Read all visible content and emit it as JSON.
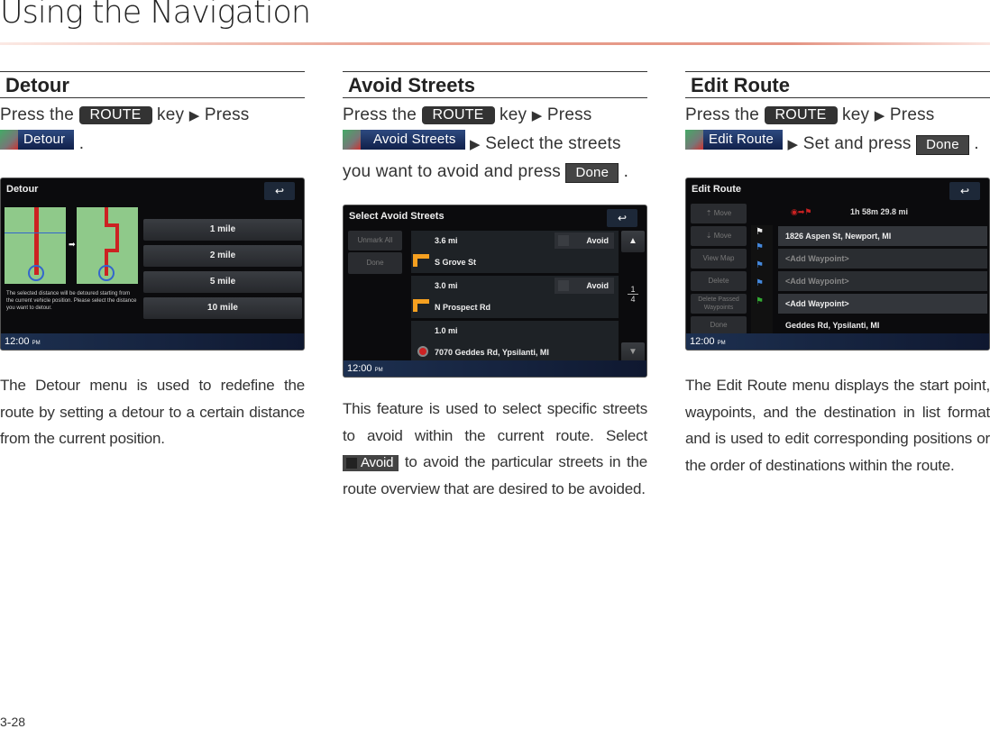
{
  "page": {
    "title": "Using the Navigation",
    "page_number": "3-28"
  },
  "common": {
    "route_key": "ROUTE",
    "key_word": "key",
    "arrow": "▶",
    "press": "Press",
    "press_the": "Press the",
    "done": "Done",
    "clock": "12:00",
    "pm": "PM",
    "back": "↩"
  },
  "detour": {
    "heading": "Detour",
    "menu_label": "Detour",
    "period": ".",
    "screen": {
      "title": "Detour",
      "options": [
        "1 mile",
        "2 mile",
        "5 mile",
        "10 mile"
      ],
      "info": "The selected distance will be detoured starting from the current vehicle position. Please select the distance you want to detour."
    },
    "description": "The Detour menu is used to redefine the route by setting a detour to a certain distance from the current position."
  },
  "avoid": {
    "heading": "Avoid Streets",
    "menu_label": "Avoid Streets",
    "step2": "Select the streets you want to avoid and press",
    "period": ".",
    "screen": {
      "title": "Select Avoid Streets",
      "side": [
        "Unmark All",
        "Done"
      ],
      "rows": [
        {
          "dist": "3.6 mi",
          "street": "S Grove St",
          "avoid": "Avoid"
        },
        {
          "dist": "3.0 mi",
          "street": "N Prospect Rd",
          "avoid": "Avoid"
        },
        {
          "dist": "1.0 mi",
          "street": "7070 Geddes Rd, Ypsilanti, MI"
        }
      ],
      "page_current": "1",
      "page_total": "4"
    },
    "description1": "This feature is used to select specific streets to avoid within the current route.",
    "select_word": "Select",
    "avoid_button": "Avoid",
    "description2": "to avoid the particular streets in the route overview that are desired to be avoided."
  },
  "edit": {
    "heading": "Edit Route",
    "menu_label": "Edit Route",
    "step2": "Set and press",
    "period": ".",
    "screen": {
      "title": "Edit Route",
      "side": [
        "Move",
        "Move",
        "View Map",
        "Delete",
        "Delete Passed Waypoints",
        "Done"
      ],
      "summary": "1h 58m  29.8 mi",
      "rows": [
        "1826 Aspen St, Newport, MI",
        "<Add Waypoint>",
        "<Add Waypoint>",
        "<Add Waypoint>",
        "Geddes Rd, Ypsilanti, MI"
      ]
    },
    "description": "The Edit Route menu displays the start point, waypoints, and the destination in list format and is used to edit corresponding positions or the order of destinations within the route."
  }
}
